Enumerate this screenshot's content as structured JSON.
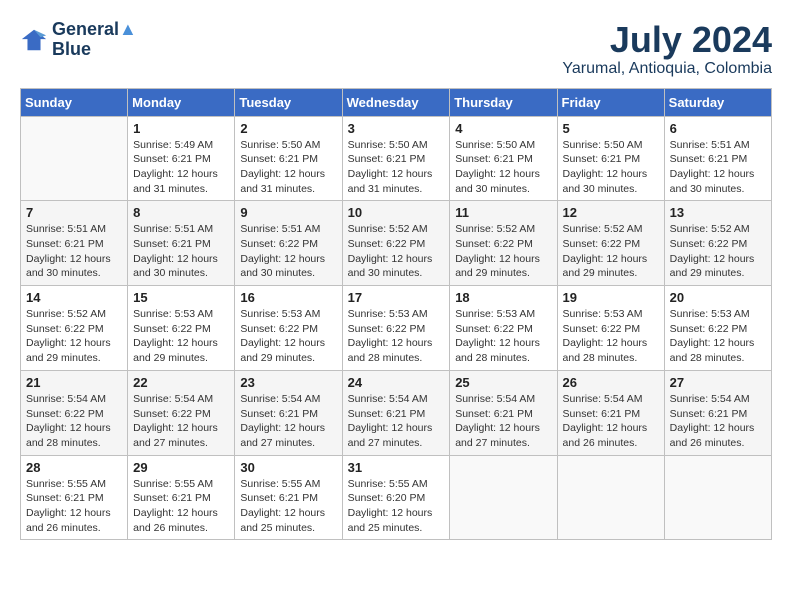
{
  "header": {
    "logo_line1": "General",
    "logo_line2": "Blue",
    "month": "July 2024",
    "location": "Yarumal, Antioquia, Colombia"
  },
  "weekdays": [
    "Sunday",
    "Monday",
    "Tuesday",
    "Wednesday",
    "Thursday",
    "Friday",
    "Saturday"
  ],
  "weeks": [
    [
      {
        "day": "",
        "info": ""
      },
      {
        "day": "1",
        "info": "Sunrise: 5:49 AM\nSunset: 6:21 PM\nDaylight: 12 hours\nand 31 minutes."
      },
      {
        "day": "2",
        "info": "Sunrise: 5:50 AM\nSunset: 6:21 PM\nDaylight: 12 hours\nand 31 minutes."
      },
      {
        "day": "3",
        "info": "Sunrise: 5:50 AM\nSunset: 6:21 PM\nDaylight: 12 hours\nand 31 minutes."
      },
      {
        "day": "4",
        "info": "Sunrise: 5:50 AM\nSunset: 6:21 PM\nDaylight: 12 hours\nand 30 minutes."
      },
      {
        "day": "5",
        "info": "Sunrise: 5:50 AM\nSunset: 6:21 PM\nDaylight: 12 hours\nand 30 minutes."
      },
      {
        "day": "6",
        "info": "Sunrise: 5:51 AM\nSunset: 6:21 PM\nDaylight: 12 hours\nand 30 minutes."
      }
    ],
    [
      {
        "day": "7",
        "info": "Sunrise: 5:51 AM\nSunset: 6:21 PM\nDaylight: 12 hours\nand 30 minutes."
      },
      {
        "day": "8",
        "info": "Sunrise: 5:51 AM\nSunset: 6:21 PM\nDaylight: 12 hours\nand 30 minutes."
      },
      {
        "day": "9",
        "info": "Sunrise: 5:51 AM\nSunset: 6:22 PM\nDaylight: 12 hours\nand 30 minutes."
      },
      {
        "day": "10",
        "info": "Sunrise: 5:52 AM\nSunset: 6:22 PM\nDaylight: 12 hours\nand 30 minutes."
      },
      {
        "day": "11",
        "info": "Sunrise: 5:52 AM\nSunset: 6:22 PM\nDaylight: 12 hours\nand 29 minutes."
      },
      {
        "day": "12",
        "info": "Sunrise: 5:52 AM\nSunset: 6:22 PM\nDaylight: 12 hours\nand 29 minutes."
      },
      {
        "day": "13",
        "info": "Sunrise: 5:52 AM\nSunset: 6:22 PM\nDaylight: 12 hours\nand 29 minutes."
      }
    ],
    [
      {
        "day": "14",
        "info": "Sunrise: 5:52 AM\nSunset: 6:22 PM\nDaylight: 12 hours\nand 29 minutes."
      },
      {
        "day": "15",
        "info": "Sunrise: 5:53 AM\nSunset: 6:22 PM\nDaylight: 12 hours\nand 29 minutes."
      },
      {
        "day": "16",
        "info": "Sunrise: 5:53 AM\nSunset: 6:22 PM\nDaylight: 12 hours\nand 29 minutes."
      },
      {
        "day": "17",
        "info": "Sunrise: 5:53 AM\nSunset: 6:22 PM\nDaylight: 12 hours\nand 28 minutes."
      },
      {
        "day": "18",
        "info": "Sunrise: 5:53 AM\nSunset: 6:22 PM\nDaylight: 12 hours\nand 28 minutes."
      },
      {
        "day": "19",
        "info": "Sunrise: 5:53 AM\nSunset: 6:22 PM\nDaylight: 12 hours\nand 28 minutes."
      },
      {
        "day": "20",
        "info": "Sunrise: 5:53 AM\nSunset: 6:22 PM\nDaylight: 12 hours\nand 28 minutes."
      }
    ],
    [
      {
        "day": "21",
        "info": "Sunrise: 5:54 AM\nSunset: 6:22 PM\nDaylight: 12 hours\nand 28 minutes."
      },
      {
        "day": "22",
        "info": "Sunrise: 5:54 AM\nSunset: 6:22 PM\nDaylight: 12 hours\nand 27 minutes."
      },
      {
        "day": "23",
        "info": "Sunrise: 5:54 AM\nSunset: 6:21 PM\nDaylight: 12 hours\nand 27 minutes."
      },
      {
        "day": "24",
        "info": "Sunrise: 5:54 AM\nSunset: 6:21 PM\nDaylight: 12 hours\nand 27 minutes."
      },
      {
        "day": "25",
        "info": "Sunrise: 5:54 AM\nSunset: 6:21 PM\nDaylight: 12 hours\nand 27 minutes."
      },
      {
        "day": "26",
        "info": "Sunrise: 5:54 AM\nSunset: 6:21 PM\nDaylight: 12 hours\nand 26 minutes."
      },
      {
        "day": "27",
        "info": "Sunrise: 5:54 AM\nSunset: 6:21 PM\nDaylight: 12 hours\nand 26 minutes."
      }
    ],
    [
      {
        "day": "28",
        "info": "Sunrise: 5:55 AM\nSunset: 6:21 PM\nDaylight: 12 hours\nand 26 minutes."
      },
      {
        "day": "29",
        "info": "Sunrise: 5:55 AM\nSunset: 6:21 PM\nDaylight: 12 hours\nand 26 minutes."
      },
      {
        "day": "30",
        "info": "Sunrise: 5:55 AM\nSunset: 6:21 PM\nDaylight: 12 hours\nand 25 minutes."
      },
      {
        "day": "31",
        "info": "Sunrise: 5:55 AM\nSunset: 6:20 PM\nDaylight: 12 hours\nand 25 minutes."
      },
      {
        "day": "",
        "info": ""
      },
      {
        "day": "",
        "info": ""
      },
      {
        "day": "",
        "info": ""
      }
    ]
  ]
}
